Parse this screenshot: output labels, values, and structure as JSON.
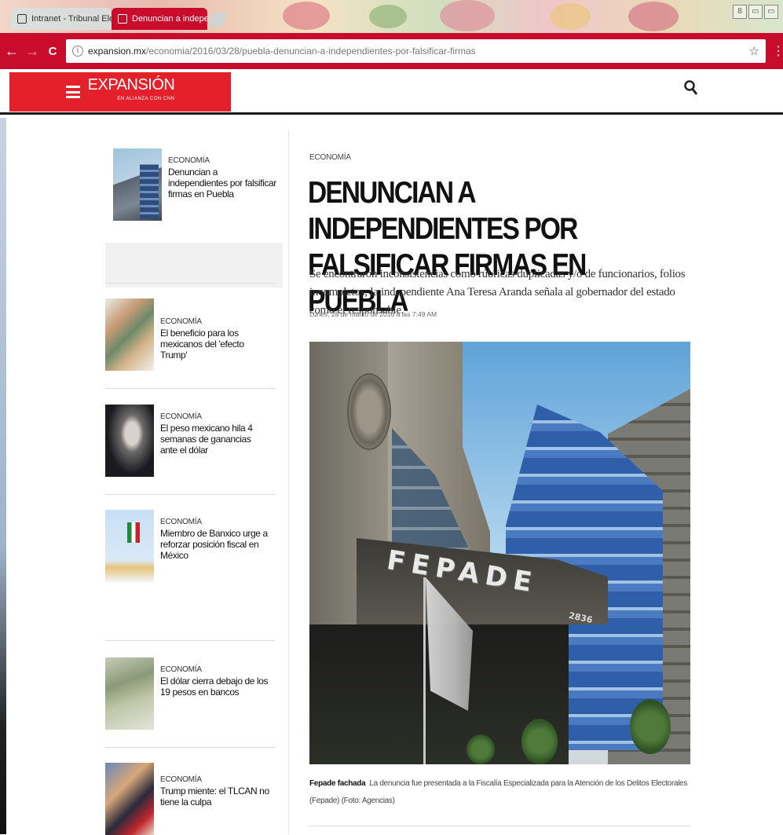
{
  "browser": {
    "tabs": [
      {
        "label": "Intranet - Tribunal Elect"
      },
      {
        "label": "Denuncian a independie"
      }
    ],
    "close_glyph": "×",
    "url_host": "expansion.mx",
    "url_path": "/economia/2016/03/28/puebla-denuncian-a-independientes-por-falsificar-firmas",
    "icons": {
      "back": "←",
      "forward": "→",
      "reload": "C",
      "info": "i",
      "star": "☆",
      "menu": "⋮"
    },
    "window_controls": [
      "8",
      "▭",
      "▭"
    ]
  },
  "site": {
    "logo": "EXPANSIÓN",
    "logo_sub": "EN ALIANZA CON CNN",
    "search_icon": "⚲",
    "brand_color": "#e4202a",
    "chrome_color": "#c90b2c"
  },
  "sidebar": {
    "items": [
      {
        "kicker": "ECONOMÍA",
        "title": "Denuncian a independientes por falsificar firmas en Puebla",
        "thumb": "building-thumbnail"
      },
      {
        "kicker": "ECONOMÍA",
        "title": "El beneficio para los mexicanos del 'efecto Trump'",
        "thumb": "money-thumbnail"
      },
      {
        "kicker": "ECONOMÍA",
        "title": "El peso mexicano hila 4 semanas de ganancias ante el dólar",
        "thumb": "face-thumbnail"
      },
      {
        "kicker": "ECONOMÍA",
        "title": "Miembro de Banxico urge a reforzar posición fiscal en México",
        "thumb": "flag-thumbnail"
      },
      {
        "kicker": "ECONOMÍA",
        "title": "El dólar cierra debajo de los 19 pesos en bancos",
        "thumb": "dollar-thumbnail"
      },
      {
        "kicker": "ECONOMÍA",
        "title": "Trump miente: el TLCAN no tiene la culpa",
        "thumb": "trump-thumbnail"
      }
    ]
  },
  "article": {
    "kicker": "ECONOMÍA",
    "headline": "DENUNCIAN A INDEPENDIENTES POR FALSIFICAR FIRMAS EN PUEBLA",
    "dek": "Se encontraron inconsistencias como rúbricas duplicadas y/o de funcionarios, folios incompletos; la independiente Ana Teresa Aranda señala al gobernador del estado como el responsable.",
    "dateline": "Lunes, 28 de marzo de 2016 a las 7:49 AM",
    "image_sign": "FEPADE",
    "image_number": "2836",
    "caption_bold": "Fepade fachada",
    "caption_text": "La denuncia fue presentada a la Fiscalía Especializada para la Atención de los Delitos Electorales (Fepade)  (Foto: Agencias)"
  }
}
